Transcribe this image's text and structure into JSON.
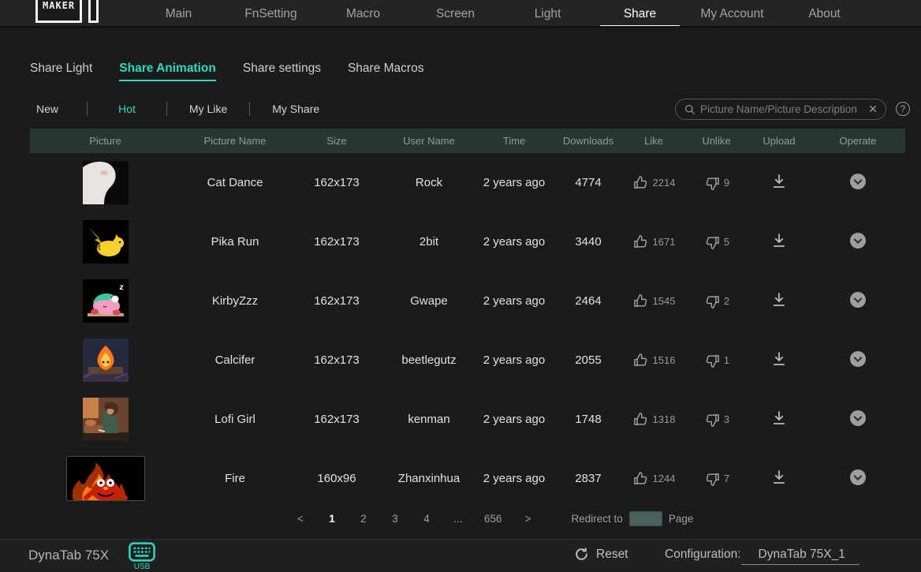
{
  "topnav": {
    "logo_text": "MAKER",
    "items": [
      {
        "label": "Main",
        "active": false
      },
      {
        "label": "FnSetting",
        "active": false
      },
      {
        "label": "Macro",
        "active": false
      },
      {
        "label": "Screen",
        "active": false
      },
      {
        "label": "Light",
        "active": false
      },
      {
        "label": "Share",
        "active": true
      },
      {
        "label": "My Account",
        "active": false
      },
      {
        "label": "About",
        "active": false
      }
    ]
  },
  "subtabs": {
    "items": [
      {
        "label": "Share Light",
        "active": false
      },
      {
        "label": "Share Animation",
        "active": true
      },
      {
        "label": "Share settings",
        "active": false
      },
      {
        "label": "Share Macros",
        "active": false
      }
    ]
  },
  "filters": {
    "items": [
      {
        "label": "New",
        "active": false
      },
      {
        "label": "Hot",
        "active": true
      },
      {
        "label": "My Like",
        "active": false
      },
      {
        "label": "My Share",
        "active": false
      }
    ]
  },
  "search": {
    "placeholder": "Picture Name/Picture Description",
    "clear_icon": "✕",
    "help_icon": "?"
  },
  "table": {
    "columns": [
      "Picture",
      "Picture Name",
      "Size",
      "User Name",
      "Time",
      "Downloads",
      "Like",
      "Unlike",
      "Upload",
      "Operate"
    ],
    "rows": [
      {
        "thumb": "cat-dance",
        "picture_name": "Cat Dance",
        "size": "162x173",
        "user_name": "Rock",
        "time": "2 years ago",
        "downloads": "4774",
        "likes": "2214",
        "unlikes": "9"
      },
      {
        "thumb": "pika-run",
        "picture_name": "Pika Run",
        "size": "162x173",
        "user_name": "2bit",
        "time": "2 years ago",
        "downloads": "3440",
        "likes": "1671",
        "unlikes": "5"
      },
      {
        "thumb": "kirby-zzz",
        "picture_name": "KirbyZzz",
        "size": "162x173",
        "user_name": "Gwape",
        "time": "2 years ago",
        "downloads": "2464",
        "likes": "1545",
        "unlikes": "2"
      },
      {
        "thumb": "calcifer",
        "picture_name": "Calcifer",
        "size": "162x173",
        "user_name": "beetlegutz",
        "time": "2 years ago",
        "downloads": "2055",
        "likes": "1516",
        "unlikes": "1"
      },
      {
        "thumb": "lofi-girl",
        "picture_name": "Lofi Girl",
        "size": "162x173",
        "user_name": "kenman",
        "time": "2 years ago",
        "downloads": "1748",
        "likes": "1318",
        "unlikes": "3"
      },
      {
        "thumb": "fire",
        "picture_name": "Fire",
        "size": "160x96",
        "user_name": "Zhanxinhua",
        "time": "2 years ago",
        "downloads": "2837",
        "likes": "1244",
        "unlikes": "7"
      }
    ]
  },
  "pagination": {
    "prev": "<",
    "next": ">",
    "pages": [
      "1",
      "2",
      "3",
      "4",
      "...",
      "656"
    ],
    "active_page": "1",
    "redirect_label": "Redirect to",
    "page_label": "Page",
    "redirect_value": ""
  },
  "footer": {
    "device_name": "DynaTab 75X",
    "usb_label": "USB",
    "reset_label": "Reset",
    "config_label": "Configuration:",
    "config_value": "DynaTab 75X_1"
  },
  "colors": {
    "accent": "#2fd9bf",
    "table_header_bg": "#2a3634",
    "background": "#1b1b1b",
    "topbar_bg": "#242424"
  }
}
